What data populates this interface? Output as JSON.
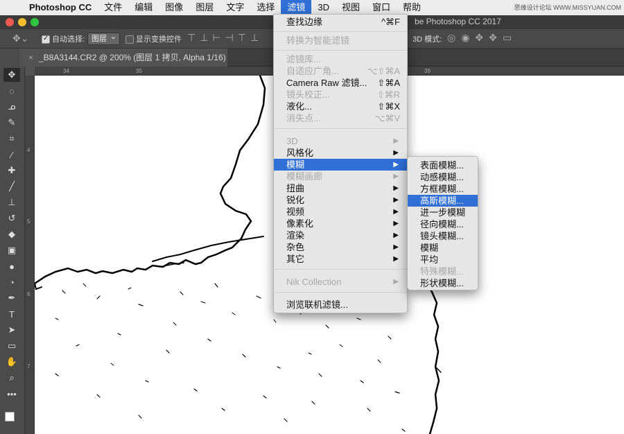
{
  "menubar": {
    "app": "Photoshop CC",
    "items": [
      "文件",
      "编辑",
      "图像",
      "图层",
      "文字",
      "选择",
      "滤镜",
      "3D",
      "视图",
      "窗口",
      "帮助"
    ],
    "active_index": 6,
    "watermark": "思缘设计论坛 WWW.MISSYUAN.COM"
  },
  "titlebar": {
    "title": "be Photoshop CC 2017"
  },
  "options": {
    "auto_select_label": "自动选择:",
    "auto_select_value": "图层",
    "show_transform_label": "显示变换控件",
    "mode3d_label": "3D 模式:"
  },
  "document": {
    "tab_title": "_B8A3144.CR2 @ 200% (图层 1 拷贝, Alpha 1/16) *",
    "close_glyph": "×"
  },
  "rulers": {
    "top": [
      "34",
      "35",
      "39"
    ],
    "left": [
      "4",
      "5",
      "6",
      "7"
    ]
  },
  "filter_menu": {
    "items": [
      {
        "label": "查找边缘",
        "shortcut": "^⌘F",
        "disabled": false
      },
      {
        "label": "转换为智能滤镜",
        "disabled": true
      },
      {
        "label": "滤镜库...",
        "disabled": true
      },
      {
        "label": "自适应广角...",
        "shortcut": "⌥⇧⌘A",
        "disabled": true
      },
      {
        "label": "Camera Raw 滤镜...",
        "shortcut": "⇧⌘A",
        "disabled": false
      },
      {
        "label": "镜头校正...",
        "shortcut": "⇧⌘R",
        "disabled": true
      },
      {
        "label": "液化...",
        "shortcut": "⇧⌘X",
        "disabled": false
      },
      {
        "label": "消失点...",
        "shortcut": "⌥⌘V",
        "disabled": true
      },
      {
        "label": "3D",
        "disabled": true,
        "submenu": true
      },
      {
        "label": "风格化",
        "submenu": true
      },
      {
        "label": "模糊",
        "submenu": true,
        "highlighted": true
      },
      {
        "label": "模糊画廊",
        "submenu": true,
        "disabled": true
      },
      {
        "label": "扭曲",
        "submenu": true
      },
      {
        "label": "锐化",
        "submenu": true
      },
      {
        "label": "视频",
        "submenu": true
      },
      {
        "label": "像素化",
        "submenu": true
      },
      {
        "label": "渲染",
        "submenu": true
      },
      {
        "label": "杂色",
        "submenu": true
      },
      {
        "label": "其它",
        "submenu": true
      },
      {
        "label": "Nik Collection",
        "submenu": true,
        "disabled": true
      },
      {
        "label": "浏览联机滤镜..."
      }
    ]
  },
  "blur_submenu": {
    "items": [
      {
        "label": "表面模糊..."
      },
      {
        "label": "动感模糊..."
      },
      {
        "label": "方框模糊..."
      },
      {
        "label": "高斯模糊...",
        "highlighted": true
      },
      {
        "label": "进一步模糊"
      },
      {
        "label": "径向模糊..."
      },
      {
        "label": "镜头模糊..."
      },
      {
        "label": "模糊"
      },
      {
        "label": "平均"
      },
      {
        "label": "特殊模糊...",
        "disabled": true
      },
      {
        "label": "形状模糊..."
      }
    ]
  },
  "colors": {
    "highlight": "#2f6fd6",
    "close_light": "#ee5a52",
    "min_light": "#f5bd2f",
    "max_light": "#2ec73f"
  },
  "tools": [
    "move-icon",
    "marquee-icon",
    "lasso-icon",
    "quick-select-icon",
    "crop-icon",
    "eyedropper-icon",
    "healing-icon",
    "brush-icon",
    "stamp-icon",
    "history-brush-icon",
    "eraser-icon",
    "gradient-icon",
    "blur-tool-icon",
    "dodge-icon",
    "pen-icon",
    "type-icon",
    "path-select-icon",
    "rectangle-icon",
    "hand-icon",
    "zoom-icon",
    "more-icon"
  ]
}
